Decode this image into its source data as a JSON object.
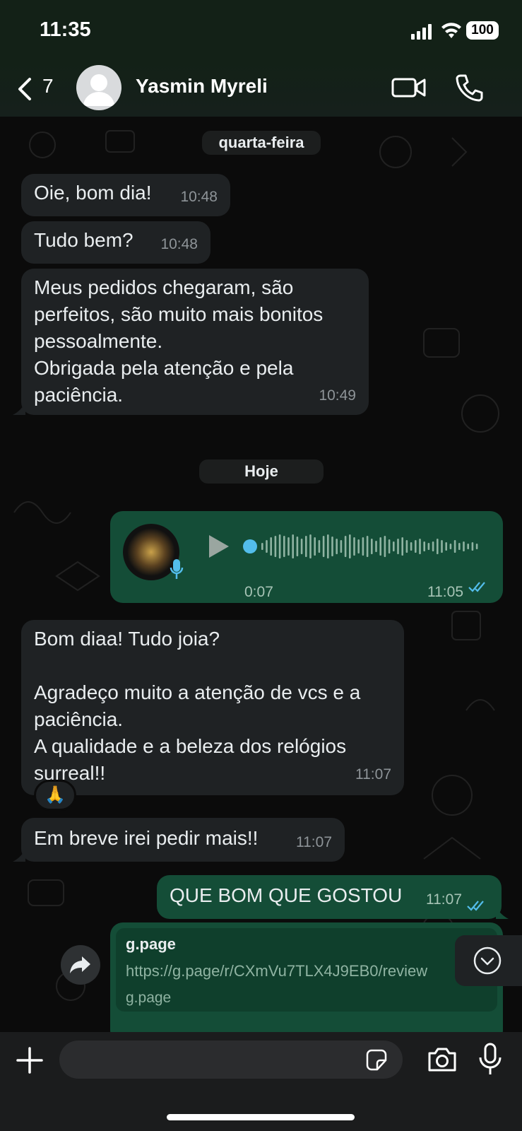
{
  "status": {
    "time": "11:35",
    "battery": "100"
  },
  "header": {
    "back_count": "7",
    "contact_name": "Yasmin Myreli"
  },
  "chat": {
    "date1": "quarta-feira",
    "m1": {
      "text": "Oie, bom dia!",
      "time": "10:48"
    },
    "m2": {
      "text": "Tudo bem?",
      "time": "10:48"
    },
    "m3": {
      "lines": [
        "Meus pedidos chegaram, são",
        "perfeitos, são muito mais bonitos",
        "pessoalmente.",
        "Obrigada pela atenção e pela",
        "paciência."
      ],
      "time": "10:49"
    },
    "date2": "Hoje",
    "voice": {
      "duration": "0:07",
      "time": "11:05",
      "progress": 0
    },
    "m4": {
      "lines": [
        "Bom diaa! Tudo joia?",
        "",
        "Agradeço muito a atenção de vcs e a",
        "paciência.",
        "A qualidade e a beleza dos relógios",
        "surreal!!"
      ],
      "time": "11:07",
      "reaction": "🙏"
    },
    "m5": {
      "text": "Em breve irei pedir mais!!",
      "time": "11:07"
    },
    "m6": {
      "text": "QUE BOM QUE GOSTOU",
      "time": "11:07"
    },
    "link": {
      "title": "g.page",
      "url": "https://g.page/r/CXmVu7TLX4J9EB0/review",
      "domain": "g.page"
    }
  },
  "colors": {
    "incoming_bubble": "#1f2224",
    "outgoing_bubble": "#144d37",
    "read_ticks": "#53bdeb",
    "background": "#0b0b0b"
  },
  "icons": [
    "back-chevron-icon",
    "video-call-icon",
    "phone-icon",
    "play-icon",
    "mic-icon",
    "forward-icon",
    "scroll-down-icon",
    "plus-icon",
    "sticker-icon",
    "camera-icon",
    "microphone-icon"
  ]
}
